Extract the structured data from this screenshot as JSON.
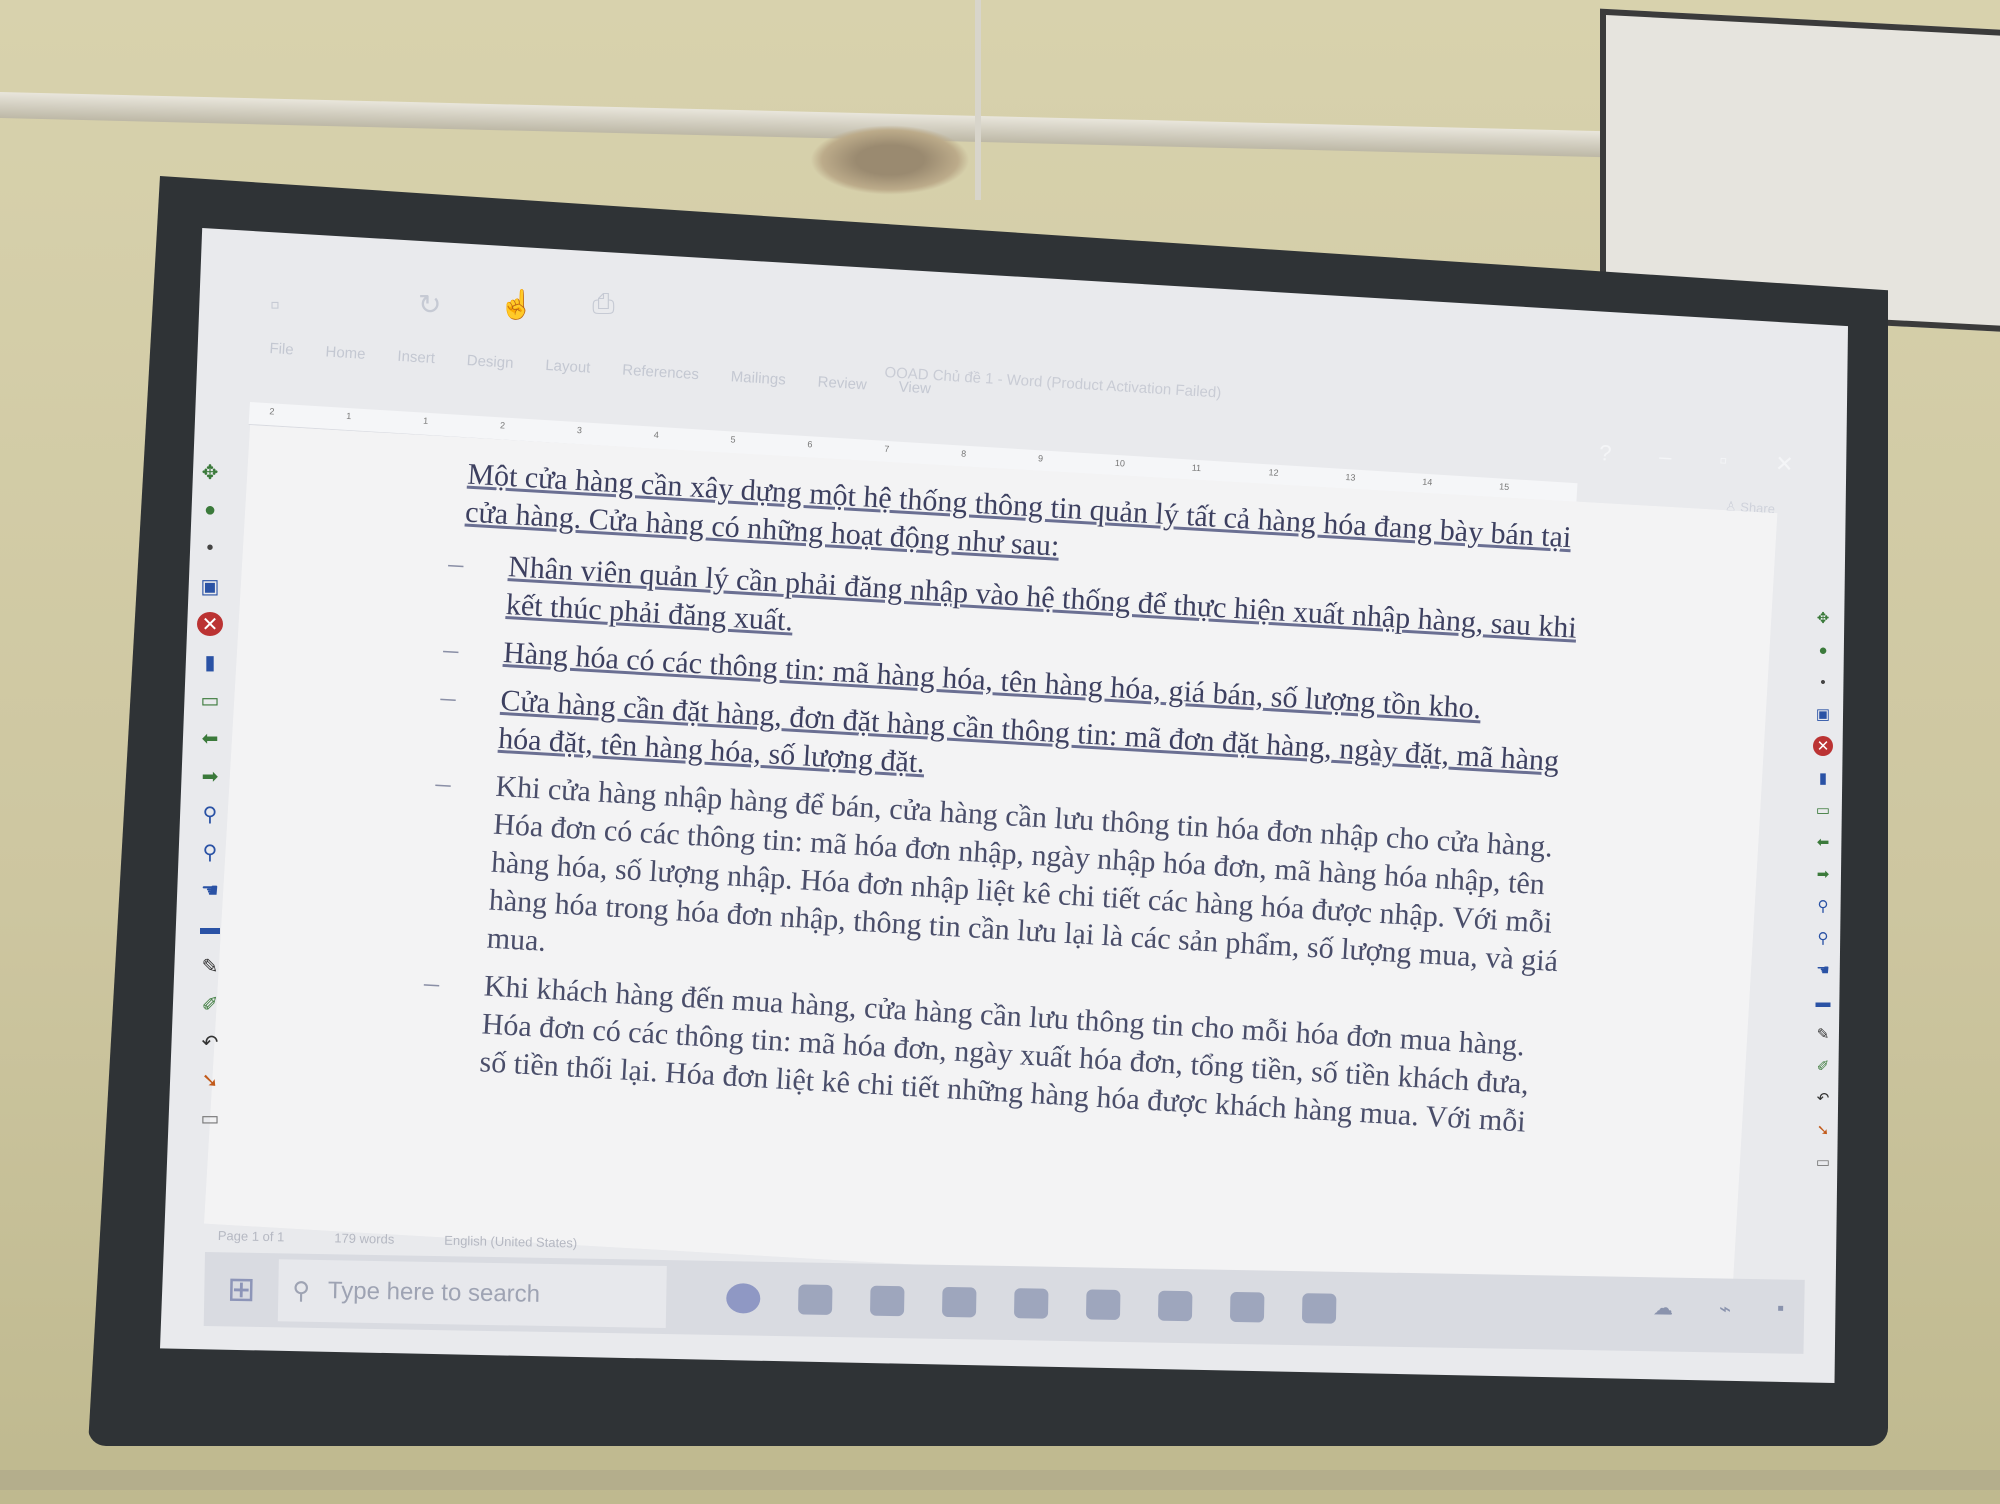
{
  "window": {
    "title": "OOAD Chủ đề 1 - Word (Product Activation Failed)",
    "share_label": "Share",
    "minimize": "–",
    "restore": "▫",
    "close": "✕",
    "help": "?"
  },
  "ribbon": {
    "tabs": [
      "File",
      "Home",
      "Insert",
      "Design",
      "Layout",
      "References",
      "Mailings",
      "Review",
      "View"
    ]
  },
  "ruler": {
    "numbers": [
      "2",
      "1",
      "1",
      "2",
      "3",
      "4",
      "5",
      "6",
      "7",
      "8",
      "9",
      "10",
      "11",
      "12",
      "13",
      "14",
      "15"
    ]
  },
  "document": {
    "intro": "Một cửa hàng cần xây dựng một hệ thống thông tin quản lý tất cả hàng hóa đang bày bán tại cửa hàng. Cửa hàng có những hoạt động như sau:",
    "bullets": [
      "Nhân viên quản lý cần phải đăng nhập vào hệ thống để thực hiện xuất nhập hàng, sau khi kết thúc phải đăng xuất.",
      "Hàng hóa có các thông tin: mã hàng hóa, tên hàng hóa, giá bán, số lượng tồn kho.",
      "Cửa hàng cần đặt hàng, đơn đặt hàng cần thông tin: mã đơn đặt hàng, ngày đặt, mã hàng hóa đặt, tên hàng hóa, số lượng đặt.",
      "Khi cửa hàng nhập hàng để bán, cửa hàng cần lưu thông tin hóa đơn nhập cho cửa hàng. Hóa đơn có các thông tin: mã hóa đơn nhập, ngày nhập hóa đơn, mã hàng hóa nhập, tên hàng hóa, số lượng nhập. Hóa đơn nhập liệt kê chi tiết các hàng hóa được nhập. Với mỗi hàng hóa trong hóa đơn nhập, thông tin cần lưu lại là các sản phẩm, số lượng mua, và giá mua.",
      "Khi khách hàng đến mua hàng, cửa hàng cần lưu thông tin cho mỗi hóa đơn mua hàng. Hóa đơn có các thông tin: mã hóa đơn, ngày xuất hóa đơn, tổng tiền, số tiền khách đưa, số tiền thối lại. Hóa đơn liệt kê chi tiết những hàng hóa được khách hàng mua. Với mỗi"
    ]
  },
  "statusbar": {
    "page": "Page 1 of 1",
    "words": "179 words",
    "language": "English (United States)"
  },
  "taskbar": {
    "start_icon": "⊞",
    "search_placeholder": "Type here to search",
    "search_icon": "⚲"
  },
  "colors": {
    "text": "#3d4060",
    "page": "#f3f3f4",
    "frame": "#2f3336"
  }
}
